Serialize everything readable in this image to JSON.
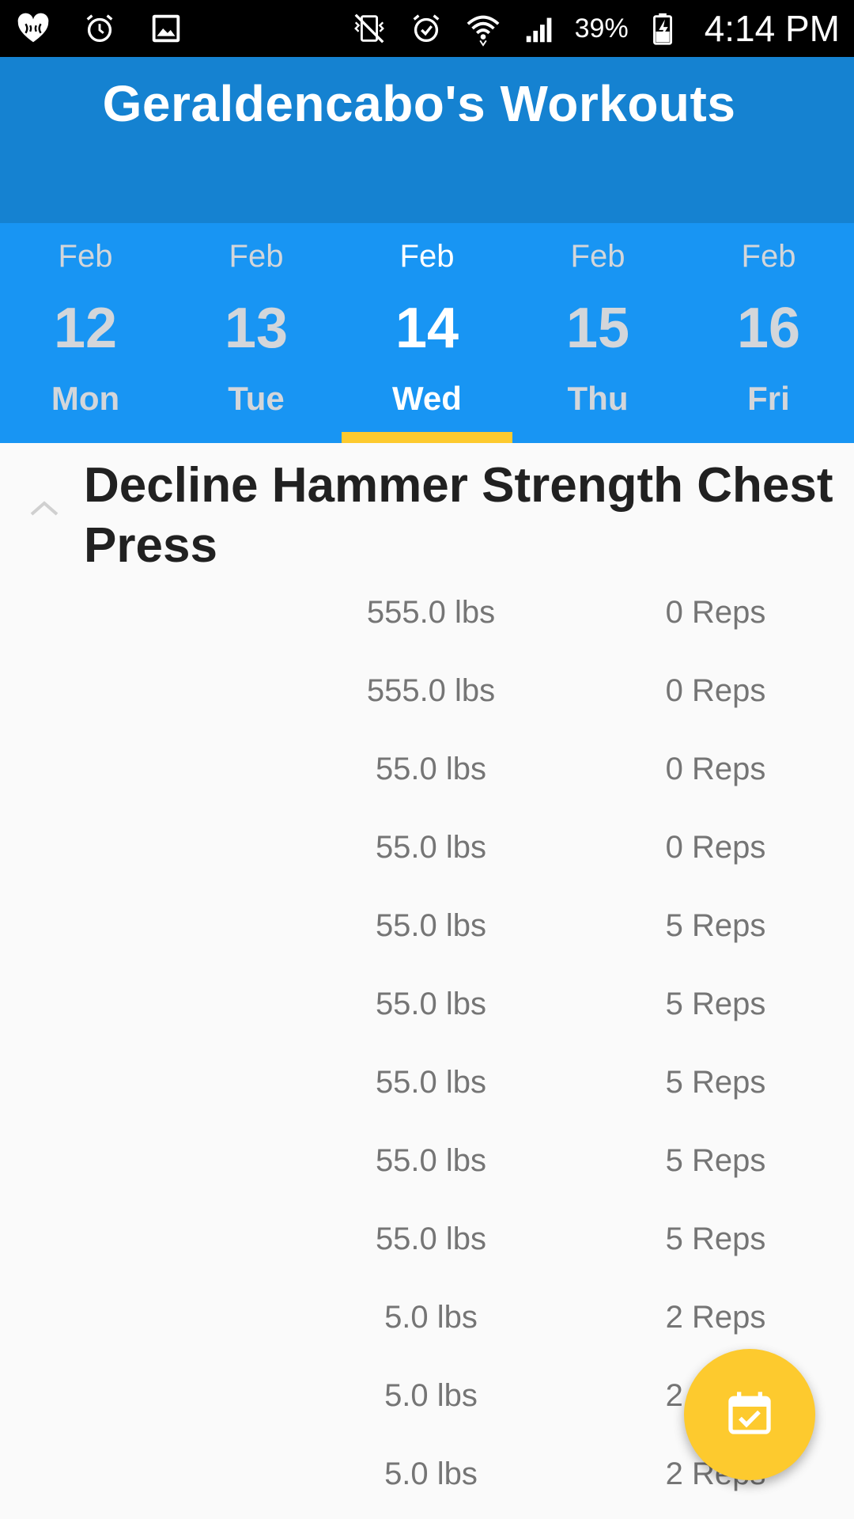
{
  "status_bar": {
    "battery_percent": "39%",
    "time": "4:14 PM",
    "left_icons": [
      "iheart-icon",
      "alarm-clock-icon",
      "image-icon"
    ],
    "right_icons": [
      "vibrate-mute-icon",
      "alarm-icon",
      "wifi-icon",
      "signal-icon",
      "battery-charging-icon"
    ]
  },
  "app_bar": {
    "title": "Geraldencabo's Workouts"
  },
  "date_tabs": [
    {
      "month": "Feb",
      "day": "12",
      "weekday": "Mon",
      "selected": false
    },
    {
      "month": "Feb",
      "day": "13",
      "weekday": "Tue",
      "selected": false
    },
    {
      "month": "Feb",
      "day": "14",
      "weekday": "Wed",
      "selected": true
    },
    {
      "month": "Feb",
      "day": "15",
      "weekday": "Thu",
      "selected": false
    },
    {
      "month": "Feb",
      "day": "16",
      "weekday": "Fri",
      "selected": false
    }
  ],
  "exercise": {
    "name": "Decline Hammer Strength Chest Press",
    "expanded": true,
    "sets": [
      {
        "weight": "555.0 lbs",
        "reps": "0 Reps"
      },
      {
        "weight": "555.0 lbs",
        "reps": "0 Reps"
      },
      {
        "weight": "55.0 lbs",
        "reps": "0 Reps"
      },
      {
        "weight": "55.0 lbs",
        "reps": "0 Reps"
      },
      {
        "weight": "55.0 lbs",
        "reps": "5 Reps"
      },
      {
        "weight": "55.0 lbs",
        "reps": "5 Reps"
      },
      {
        "weight": "55.0 lbs",
        "reps": "5 Reps"
      },
      {
        "weight": "55.0 lbs",
        "reps": "5 Reps"
      },
      {
        "weight": "55.0 lbs",
        "reps": "5 Reps"
      },
      {
        "weight": "5.0 lbs",
        "reps": "2 Reps"
      },
      {
        "weight": "5.0 lbs",
        "reps": "2 Reps"
      },
      {
        "weight": "5.0 lbs",
        "reps": "2 Reps"
      }
    ]
  },
  "fab": {
    "icon": "calendar-check-icon"
  },
  "colors": {
    "app_bar": "#1582d1",
    "tabs_bar": "#1895f3",
    "accent": "#fdca2e",
    "background": "#fafafa"
  }
}
